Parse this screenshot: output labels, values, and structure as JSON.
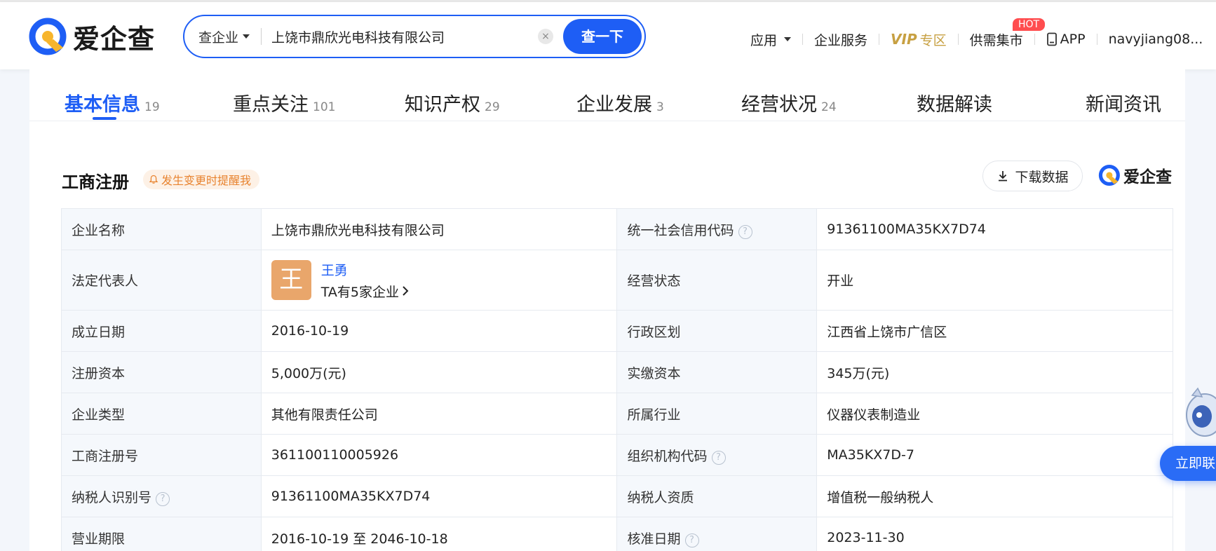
{
  "header": {
    "logo_text": "爱企查",
    "search": {
      "type_label": "查企业",
      "value": "上饶市鼎欣光电科技有限公司",
      "clear": "×",
      "button": "查一下"
    },
    "nav": {
      "apps": "应用",
      "enterprise_services": "企业服务",
      "vip": "VIP",
      "vip_suffix": "专区",
      "supply_market": "供需集市",
      "hot_badge": "HOT",
      "app": "APP",
      "user": "navyjiang08..."
    }
  },
  "tabs": [
    {
      "label": "基本信息",
      "count": "19"
    },
    {
      "label": "重点关注",
      "count": "101"
    },
    {
      "label": "知识产权",
      "count": "29"
    },
    {
      "label": "企业发展",
      "count": "3"
    },
    {
      "label": "经营状况",
      "count": "24"
    },
    {
      "label": "数据解读",
      "count": ""
    },
    {
      "label": "新闻资讯",
      "count": ""
    }
  ],
  "section": {
    "title": "工商注册",
    "remind": "发生变更时提醒我",
    "download": "下载数据",
    "brand": "爱企查"
  },
  "table": {
    "rows": [
      {
        "l1": "企业名称",
        "v1": "上饶市鼎欣光电科技有限公司",
        "l2": "统一社会信用代码",
        "v2": "91361100MA35KX7D74"
      },
      {
        "l1": "法定代表人",
        "l2": "经营状态",
        "v2": "开业"
      },
      {
        "l1": "成立日期",
        "v1": "2016-10-19",
        "l2": "行政区划",
        "v2": "江西省上饶市广信区"
      },
      {
        "l1": "注册资本",
        "v1": "5,000万(元)",
        "l2": "实缴资本",
        "v2": "345万(元)"
      },
      {
        "l1": "企业类型",
        "v1": "其他有限责任公司",
        "l2": "所属行业",
        "v2": "仪器仪表制造业"
      },
      {
        "l1": "工商注册号",
        "v1": "361100110005926",
        "l2": "组织机构代码",
        "v2": "MA35KX7D-7"
      },
      {
        "l1": "纳税人识别号",
        "v1": "91361100MA35KX7D74",
        "l2": "纳税人资质",
        "v2": "增值税一般纳税人"
      },
      {
        "l1": "营业期限",
        "v1": "2016-10-19 至 2046-10-18",
        "l2": "核准日期",
        "v2": "2023-11-30"
      }
    ],
    "legal_rep": {
      "avatar_char": "王",
      "name": "王勇",
      "companies": "TA有5家企业"
    },
    "help": "?"
  },
  "float": {
    "button": "立即联"
  },
  "colors": {
    "primary": "#1e5ef5",
    "vip": "#c7a042",
    "remind": "#e8832f",
    "avatar": "#e9a66b",
    "hot": "#ff4d4f"
  }
}
